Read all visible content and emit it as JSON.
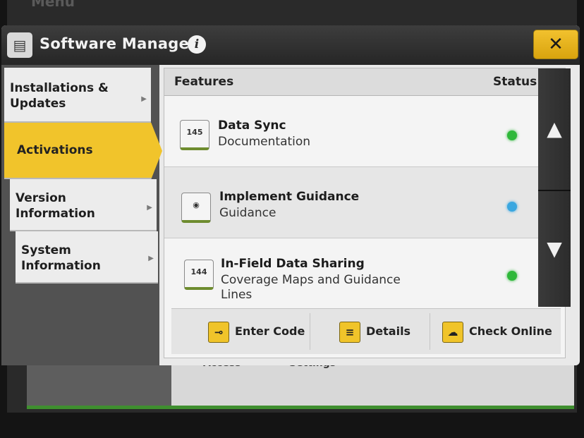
{
  "background": {
    "menu_label": "Menu",
    "bottom_left": "Access",
    "bottom_right": "Settings"
  },
  "titlebar": {
    "app_icon": "software-manager-icon",
    "title": "Software Manager",
    "info_glyph": "i",
    "close_glyph": "✕"
  },
  "nav": {
    "items": [
      {
        "label": "Installations & Updates",
        "active": false
      },
      {
        "label": "Activations",
        "active": true
      },
      {
        "label": "Version Information",
        "active": false
      },
      {
        "label": "System Information",
        "active": false
      }
    ],
    "active_color": "#f1c42b"
  },
  "table": {
    "features_header": "Features",
    "status_header": "Status",
    "rows": [
      {
        "title": "Data Sync",
        "subtitle": "Documentation",
        "icon": "counter-icon",
        "status_color": "#2fb83a"
      },
      {
        "title": "Implement Guidance",
        "subtitle": "Guidance",
        "icon": "implement-guidance-icon",
        "status_color": "#3aa7e0"
      },
      {
        "title": "In-Field Data Sharing",
        "subtitle": "Coverage Maps and Guidance Lines",
        "icon": "counter-icon",
        "status_color": "#2fb83a"
      }
    ]
  },
  "actions": {
    "enter_code": "Enter Code",
    "details": "Details",
    "check_online": "Check Online"
  },
  "colors": {
    "accent_yellow": "#f1c42b",
    "status_green": "#2fb83a",
    "status_blue": "#3aa7e0"
  }
}
